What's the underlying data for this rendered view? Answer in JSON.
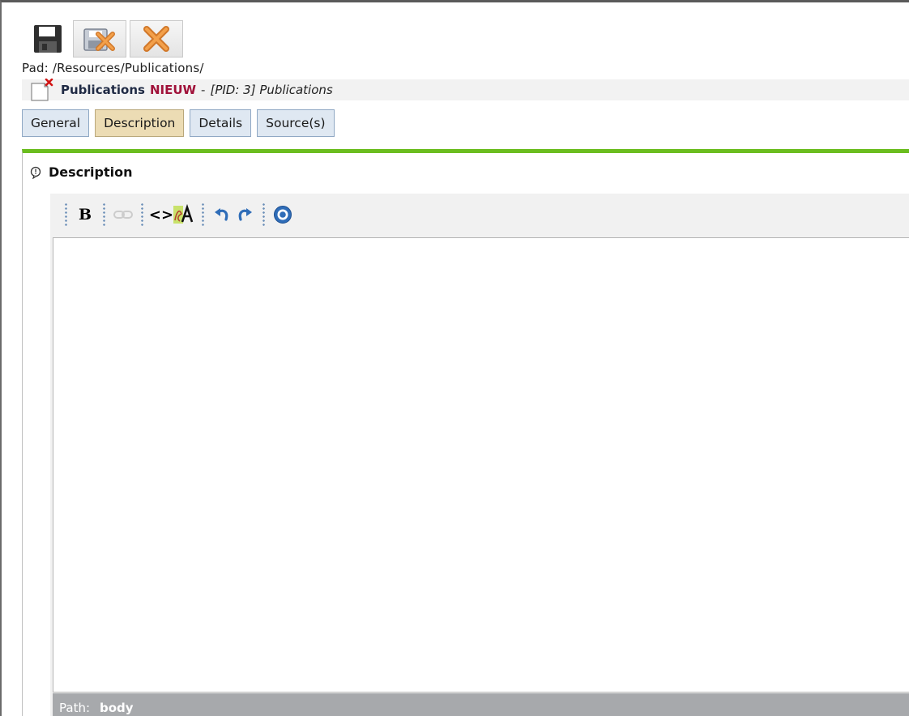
{
  "toolbar": {
    "save": {
      "icon": "floppy-disk-icon"
    },
    "save_close": {
      "icon": "save-close-icon"
    },
    "close": {
      "icon": "close-x-icon"
    }
  },
  "path_line": "Pad: /Resources/Publications/",
  "record": {
    "title": "Publications",
    "status": "NIEUW",
    "separator": "-",
    "meta": "[PID: 3] Publications",
    "icon": "new-document-icon"
  },
  "tabs": [
    {
      "label": "General",
      "active": false
    },
    {
      "label": "Description",
      "active": true
    },
    {
      "label": "Details",
      "active": false
    },
    {
      "label": "Source(s)",
      "active": false
    }
  ],
  "panel": {
    "title": "Description",
    "icon": "help-bubble-icon"
  },
  "editor": {
    "buttons": {
      "bold": "B",
      "link": "link-icon",
      "source": "<>",
      "spellcheck": "spellcheck-icon",
      "undo": "undo-icon",
      "redo": "redo-icon",
      "help": "help-icon"
    },
    "content": "",
    "status_label": "Path:",
    "status_path": "body"
  },
  "colors": {
    "accent_green": "#6bbd1f",
    "tab_active": "#ecdcb4",
    "tab_inactive": "#dfe8f2",
    "status_new": "#a0123a"
  }
}
